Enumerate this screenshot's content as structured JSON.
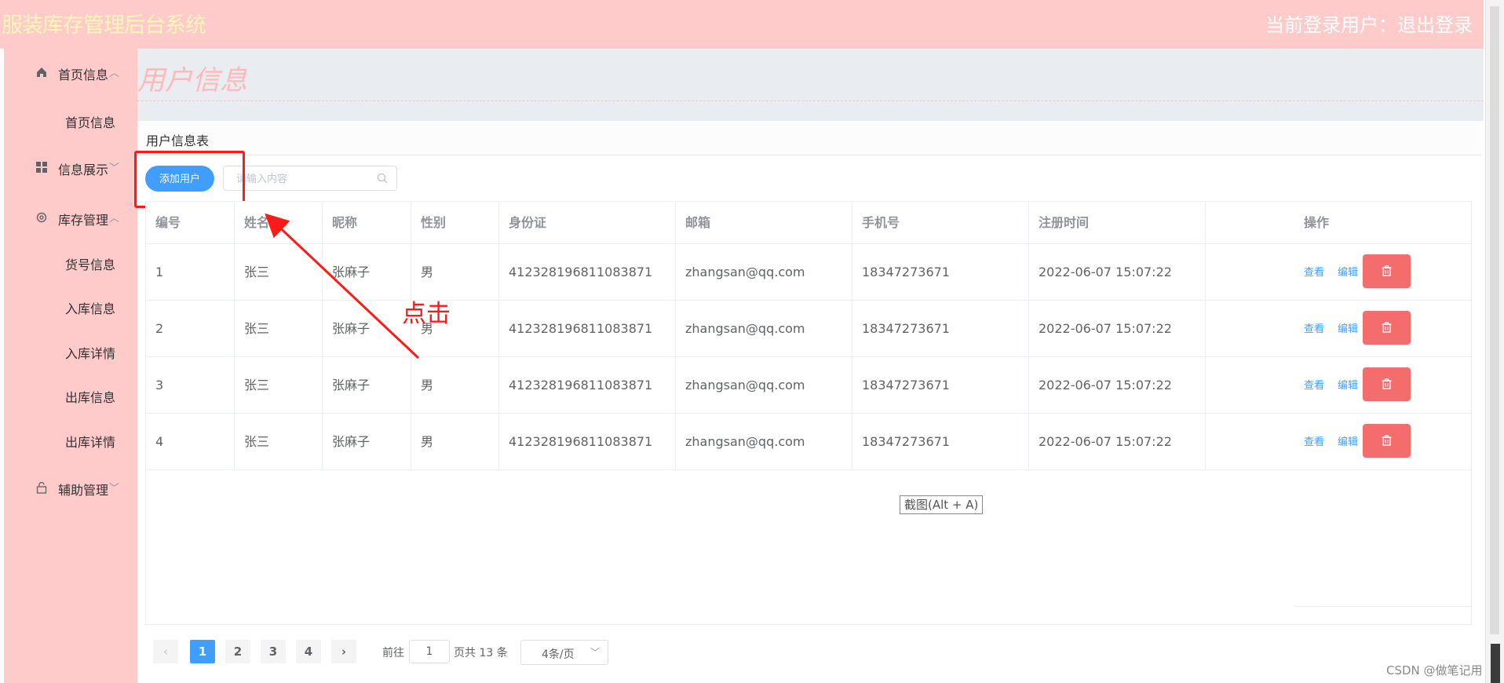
{
  "header": {
    "app_title": "服装库存管理后台系统",
    "user_text": "当前登录用户：",
    "logout": "退出登录"
  },
  "sidebar": {
    "groups": [
      {
        "label": "首页信息",
        "icon": "home-icon",
        "arrow": "^",
        "items": [
          "首页信息"
        ]
      },
      {
        "label": "信息展示",
        "icon": "grid-icon",
        "arrow": "v",
        "items": []
      },
      {
        "label": "库存管理",
        "icon": "gear-icon",
        "arrow": "^",
        "items": [
          "货号信息",
          "入库信息",
          "入库详情",
          "出库信息",
          "出库详情"
        ]
      },
      {
        "label": "辅助管理",
        "icon": "lock-icon",
        "arrow": "v",
        "items": []
      }
    ]
  },
  "page": {
    "title": "用户信息",
    "card_title": "用户信息表"
  },
  "toolbar": {
    "add_label": "添加用户",
    "search_placeholder": "请输入内容"
  },
  "table": {
    "columns": [
      "编号",
      "姓名",
      "昵称",
      "性别",
      "身份证",
      "邮箱",
      "手机号",
      "注册时间",
      "操作"
    ],
    "rows": [
      [
        "1",
        "张三",
        "张麻子",
        "男",
        "412328196811083871",
        "zhangsan@qq.com",
        "18347273671",
        "2022-06-07 15:07:22"
      ],
      [
        "2",
        "张三",
        "张麻子",
        "男",
        "412328196811083871",
        "zhangsan@qq.com",
        "18347273671",
        "2022-06-07 15:07:22"
      ],
      [
        "3",
        "张三",
        "张麻子",
        "男",
        "412328196811083871",
        "zhangsan@qq.com",
        "18347273671",
        "2022-06-07 15:07:22"
      ],
      [
        "4",
        "张三",
        "张麻子",
        "男",
        "412328196811083871",
        "zhangsan@qq.com",
        "18347273671",
        "2022-06-07 15:07:22"
      ]
    ],
    "view_label": "查看",
    "edit_label": "编辑"
  },
  "screenshot_hint": "截图(Alt + A)",
  "annotation": {
    "text": "点击",
    "color": "#ff1a1a"
  },
  "pagination": {
    "pages": [
      "1",
      "2",
      "3",
      "4"
    ],
    "current": "1",
    "goto_prefix": "前往",
    "goto_value": "1",
    "total_text": "页共 13 条",
    "page_size": "4条/页"
  },
  "watermark": "CSDN @做笔记用",
  "colors": {
    "header_bg": "#ffcaca",
    "primary": "#409eff",
    "danger": "#f56c6c",
    "annotation": "#ff1a1a"
  }
}
